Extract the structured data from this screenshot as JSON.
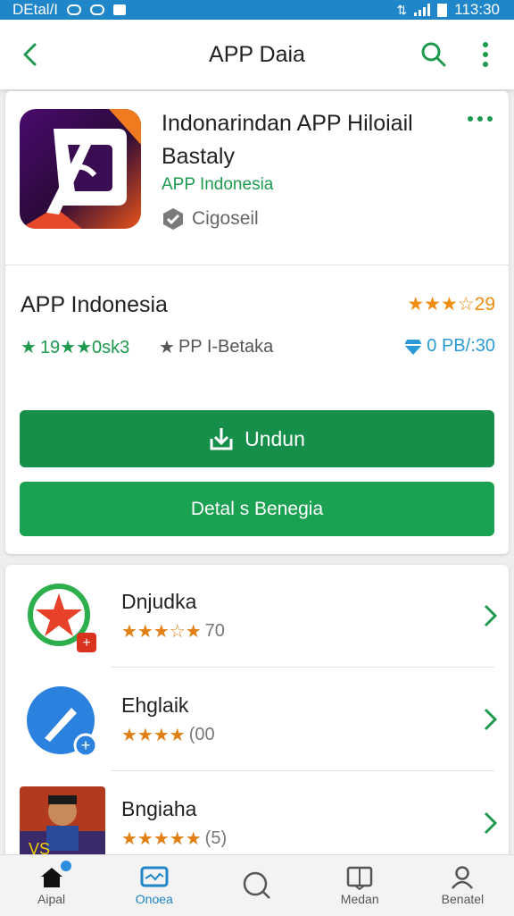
{
  "status_bar": {
    "carrier": "DEtal/I",
    "time": "113:30"
  },
  "app_bar": {
    "title": "APP Daia"
  },
  "app": {
    "name": "Indonarindan APP Hiloiail Bastaly",
    "developer_link": "APP Indonesia",
    "verified_label": "Cigoseil"
  },
  "developer_row": {
    "name": "APP Indonesia",
    "rating": "29"
  },
  "stats": [
    {
      "text": "19★★0sk3"
    },
    {
      "text": "PP I-Betaka"
    },
    {
      "text": "0 PB/:30"
    }
  ],
  "buttons": {
    "primary": "Undun",
    "secondary": "Detal s Benegia"
  },
  "related": [
    {
      "name": "Dnjudka",
      "stars": 4,
      "count": "70"
    },
    {
      "name": "Ehglaik",
      "stars": 4,
      "count": "(00"
    },
    {
      "name": "Bngiaha",
      "stars": 5,
      "count": "(5)"
    }
  ],
  "bottom_nav": [
    {
      "label": "Aipal",
      "icon": "home-icon"
    },
    {
      "label": "Onoea",
      "icon": "monitor-icon"
    },
    {
      "label": "",
      "icon": "search-icon"
    },
    {
      "label": "Medan",
      "icon": "book-icon"
    },
    {
      "label": "Benatel",
      "icon": "person-icon"
    }
  ],
  "colors": {
    "green": "#158f49",
    "blue": "#1f86c9",
    "orange": "#f08c12"
  }
}
